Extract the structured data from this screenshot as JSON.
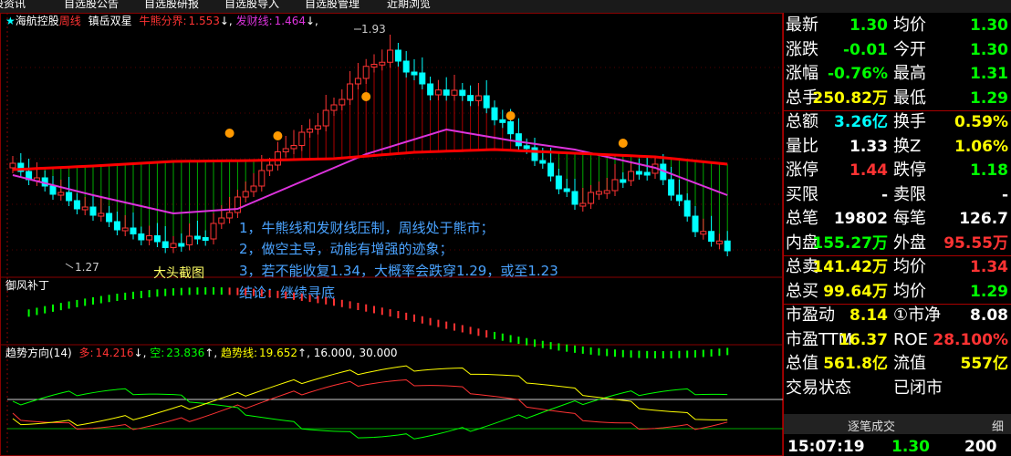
{
  "menu": [
    "选股资讯",
    "自选股公告",
    "自选股研报",
    "自选股导入",
    "自选股管理",
    "近期浏览"
  ],
  "main_header": {
    "star": "★",
    "stock_name": "海航控股",
    "period": "周线",
    "indicator_name": "镇岳双星",
    "bull_label": "牛熊分界:",
    "bull_value": "1.553",
    "bull_arrow": "↓,",
    "fortune_label": "发财线:",
    "fortune_value": "1.464",
    "fortune_arrow": "↓,"
  },
  "price_marks": {
    "high": "1.93",
    "low": "1.27"
  },
  "annotations": {
    "line1": "1，牛熊线和发财线压制，周线处于熊市；",
    "line2": "2，做空主导，动能有增强的迹象；",
    "line3": "3，若不能收复1.34，大概率会跌穿1.29，或至1.23",
    "line4": "结论：继续寻底",
    "watermark": "大头截图"
  },
  "sub1_label": "御风补丁",
  "sub2_header": {
    "name": "趋势方向(14)",
    "long_label": "多:",
    "long_value": "14.216",
    "long_arrow": "↓,",
    "short_label": "空:",
    "short_value": "23.836",
    "short_arrow": "↑,",
    "trend_label": "趋势线:",
    "trend_value": "19.652",
    "trend_arrow": "↑,",
    "lvl1": "16.000,",
    "lvl2": "30.000"
  },
  "quote": [
    {
      "l1": "最新",
      "v1": "1.30",
      "c1": "#00ff00",
      "l2": "均价",
      "v2": "1.30",
      "c2": "#00ff00"
    },
    {
      "l1": "涨跌",
      "v1": "-0.01",
      "c1": "#00ff00",
      "l2": "今开",
      "v2": "1.30",
      "c2": "#00ff00"
    },
    {
      "l1": "涨幅",
      "v1": "-0.76%",
      "c1": "#00ff00",
      "l2": "最高",
      "v2": "1.31",
      "c2": "#00ff00"
    },
    {
      "l1": "总手",
      "v1": "250.82万",
      "c1": "#ffff00",
      "l2": "最低",
      "v2": "1.29",
      "c2": "#00ff00"
    },
    {
      "l1": "总额",
      "v1": "3.26亿",
      "c1": "#00ffff",
      "l2": "换手",
      "v2": "0.59%",
      "c2": "#ffff00"
    },
    {
      "l1": "量比",
      "v1": "1.33",
      "c1": "#ffffff",
      "l2": "换Z",
      "v2": "1.06%",
      "c2": "#ffff00"
    },
    {
      "l1": "涨停",
      "v1": "1.44",
      "c1": "#ff3333",
      "l2": "跌停",
      "v2": "1.18",
      "c2": "#00ff00"
    },
    {
      "l1": "买限",
      "v1": "-",
      "c1": "#ffffff",
      "l2": "卖限",
      "v2": "-",
      "c2": "#ffffff"
    },
    {
      "l1": "总笔",
      "v1": "19802",
      "c1": "#ffffff",
      "l2": "每笔",
      "v2": "126.7",
      "c2": "#ffffff"
    },
    {
      "l1": "内盘",
      "v1": "155.27万",
      "c1": "#00ff00",
      "l2": "外盘",
      "v2": "95.55万",
      "c2": "#ff3333"
    },
    {
      "l1": "总卖",
      "v1": "141.42万",
      "c1": "#ffff00",
      "l2": "均价",
      "v2": "1.34",
      "c2": "#ff3333"
    },
    {
      "l1": "总买",
      "v1": "99.64万",
      "c1": "#ffff00",
      "l2": "均价",
      "v2": "1.29",
      "c2": "#00ff00"
    },
    {
      "l1": "市盈动",
      "v1": "8.14",
      "c1": "#ffff00",
      "l2": "①市净",
      "v2": "8.08",
      "c2": "#ffffff"
    },
    {
      "l1": "市盈TTM",
      "v1": "16.37",
      "c1": "#ffff00",
      "l2": "ROE",
      "v2": "28.100%",
      "c2": "#ff3333"
    },
    {
      "l1": "总值",
      "v1": "561.8亿",
      "c1": "#ffff00",
      "l2": "流值",
      "v2": "557亿",
      "c2": "#ffff00"
    },
    {
      "l1": "交易状态",
      "v1": "",
      "c1": "#ffffff",
      "l2": "已闭市",
      "v2": "",
      "c2": "#ffffff"
    }
  ],
  "tabs": {
    "ticks_tab": "逐笔成交",
    "detail_tab": "细"
  },
  "tick": {
    "time": "15:07:19",
    "price": "1.30",
    "volume": "200"
  },
  "colors": {
    "up": "#ff3333",
    "down": "#00ffff",
    "bull_line": "#ff0000",
    "fortune_line": "#dd33dd",
    "grid": "#880000"
  }
}
